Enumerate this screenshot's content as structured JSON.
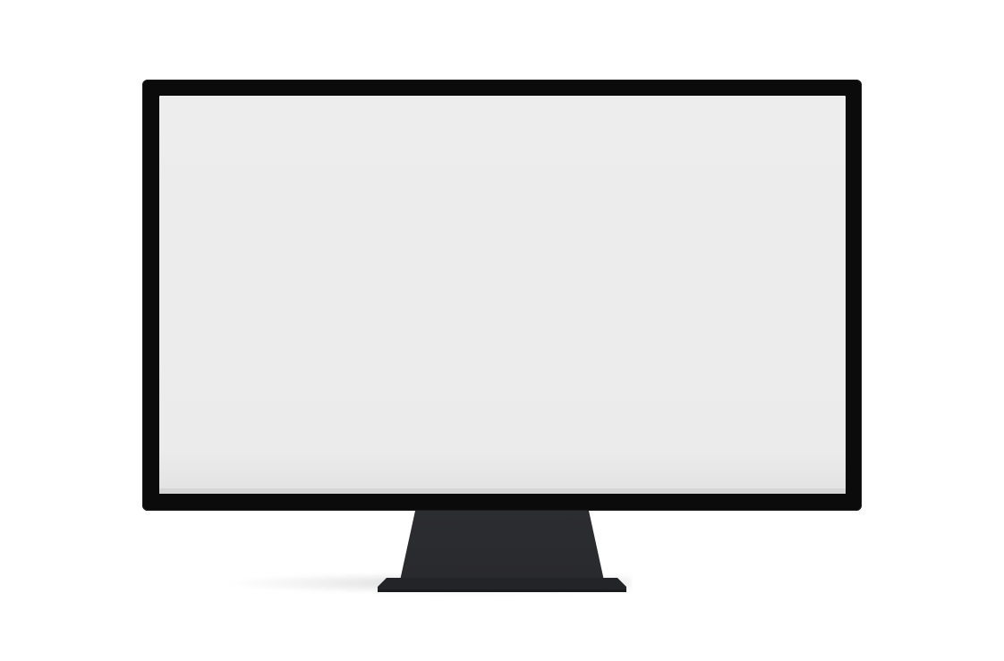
{
  "monitor": {
    "bezel_color": "#0b0b0c",
    "screen_color": "#ebebeb",
    "stand_color": "#2a2b2e",
    "background_color": "#ffffff",
    "screen_content": ""
  }
}
